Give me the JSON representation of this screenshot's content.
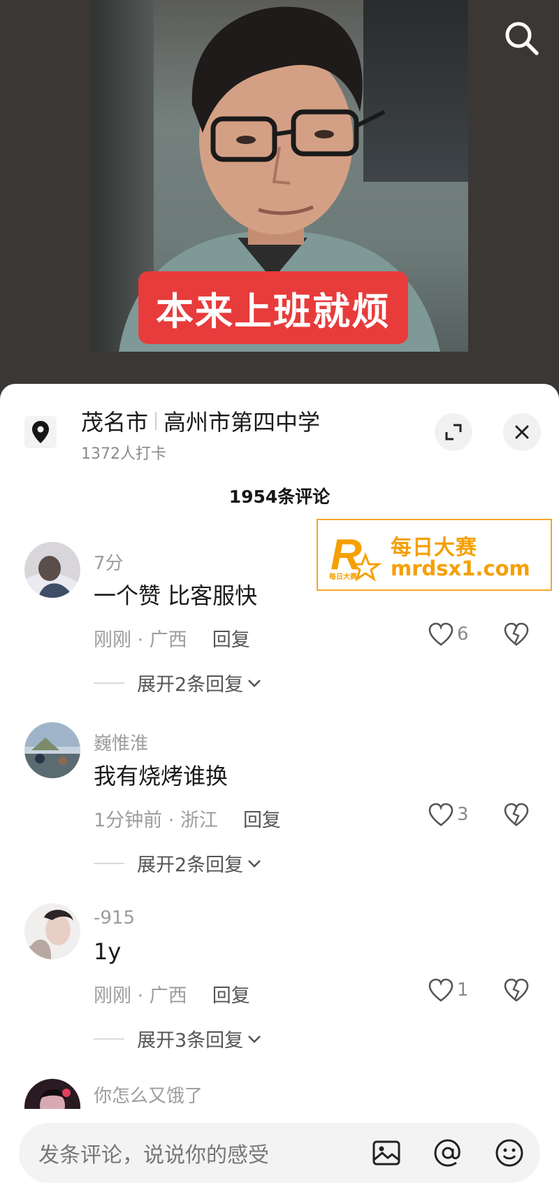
{
  "video": {
    "caption": "本来上班就烦"
  },
  "location": {
    "city": "茂名市",
    "place": "高州市第四中学",
    "checkins": "1372人打卡"
  },
  "comments_header": {
    "count": "1954条评论"
  },
  "watermark": {
    "brand_cn": "每日大赛",
    "domain": "mrdsx1.com",
    "logo_letter": "R",
    "logo_small": "每日大赛"
  },
  "comments": [
    {
      "user": "7分",
      "text": "一个赞 比客服快",
      "time_region": "刚刚 · 广西",
      "reply": "回复",
      "likes": "6",
      "expand": "展开2条回复"
    },
    {
      "user": "巍惟淮",
      "text": "我有烧烤谁换",
      "time_region": "1分钟前 · 浙江",
      "reply": "回复",
      "likes": "3",
      "expand": "展开2条回复"
    },
    {
      "user": "-915",
      "text": "1y",
      "time_region": "刚刚 · 广西",
      "reply": "回复",
      "likes": "1",
      "expand": "展开3条回复"
    },
    {
      "user": "你怎么又饿了"
    }
  ],
  "input_bar": {
    "placeholder": "发条评论，说说你的感受"
  },
  "icons": {
    "search": "search-icon",
    "location": "location-pin-icon",
    "expand": "expand-icon",
    "close": "close-icon",
    "like": "heart-icon",
    "dislike": "broken-heart-icon",
    "chevron": "chevron-down-icon",
    "image": "image-icon",
    "mention": "at-icon",
    "emoji": "emoji-icon"
  },
  "colors": {
    "caption_bg": "#e83b3b",
    "watermark": "#f5a000",
    "sheet_bg": "#ffffff"
  }
}
